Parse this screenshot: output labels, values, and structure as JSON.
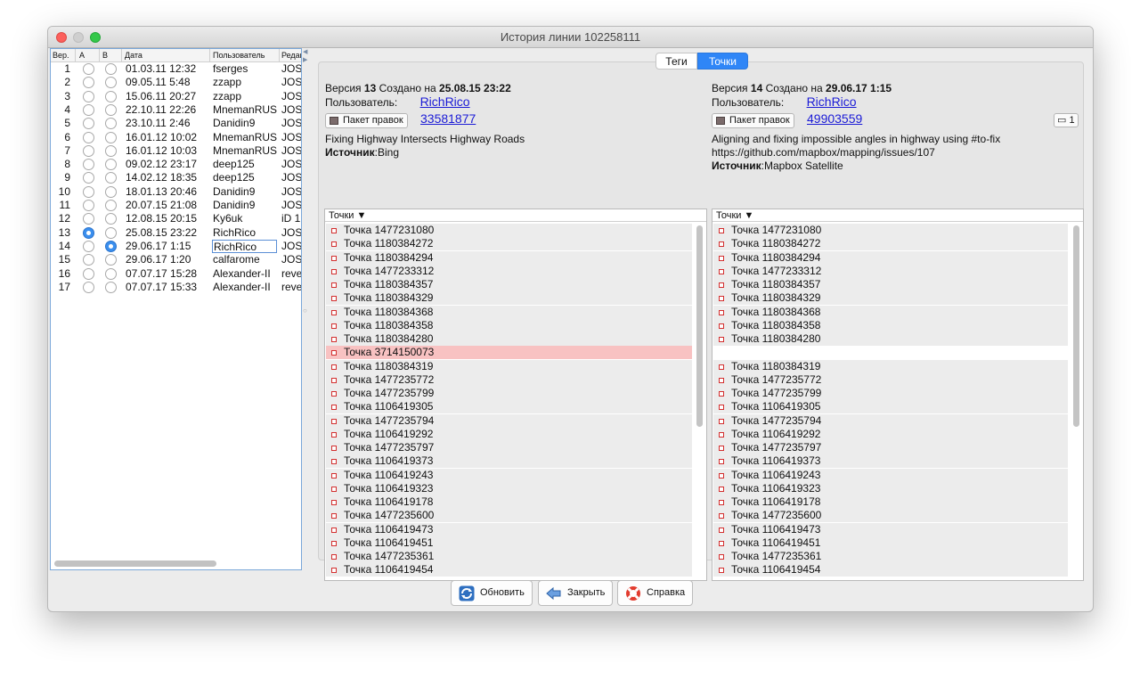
{
  "window": {
    "title": "История линии 102258111"
  },
  "history": {
    "headers": {
      "ver": "Вер.",
      "a": "A",
      "b": "B",
      "date": "Дата",
      "user": "Пользователь",
      "editor": "Редакт"
    },
    "rows": [
      {
        "n": "1",
        "date": "01.03.11 12:32",
        "user": "fserges",
        "editor": "JOSM",
        "a": false,
        "b": false
      },
      {
        "n": "2",
        "date": "09.05.11 5:48",
        "user": "zzapp",
        "editor": "JOSM",
        "a": false,
        "b": false
      },
      {
        "n": "3",
        "date": "15.06.11 20:27",
        "user": "zzapp",
        "editor": "JOSM",
        "a": false,
        "b": false
      },
      {
        "n": "4",
        "date": "22.10.11 22:26",
        "user": "MnemanRUS",
        "editor": "JOSM",
        "a": false,
        "b": false
      },
      {
        "n": "5",
        "date": "23.10.11 2:46",
        "user": "Danidin9",
        "editor": "JOSM",
        "a": false,
        "b": false
      },
      {
        "n": "6",
        "date": "16.01.12 10:02",
        "user": "MnemanRUS",
        "editor": "JOSM",
        "a": false,
        "b": false
      },
      {
        "n": "7",
        "date": "16.01.12 10:03",
        "user": "MnemanRUS",
        "editor": "JOSM",
        "a": false,
        "b": false
      },
      {
        "n": "8",
        "date": "09.02.12 23:17",
        "user": "deep125",
        "editor": "JOSM",
        "a": false,
        "b": false
      },
      {
        "n": "9",
        "date": "14.02.12 18:35",
        "user": "deep125",
        "editor": "JOSM",
        "a": false,
        "b": false
      },
      {
        "n": "10",
        "date": "18.01.13 20:46",
        "user": "Danidin9",
        "editor": "JOSM",
        "a": false,
        "b": false
      },
      {
        "n": "11",
        "date": "20.07.15 21:08",
        "user": "Danidin9",
        "editor": "JOSM",
        "a": false,
        "b": false
      },
      {
        "n": "12",
        "date": "12.08.15 20:15",
        "user": "Ky6uk",
        "editor": "iD 1",
        "a": false,
        "b": false
      },
      {
        "n": "13",
        "date": "25.08.15 23:22",
        "user": "RichRico",
        "editor": "JOSM",
        "a": true,
        "b": false
      },
      {
        "n": "14",
        "date": "29.06.17 1:15",
        "user": "RichRico",
        "editor": "JOSM",
        "a": false,
        "b": true,
        "selected": true
      },
      {
        "n": "15",
        "date": "29.06.17 1:20",
        "user": "calfarome",
        "editor": "JOSM",
        "a": false,
        "b": false
      },
      {
        "n": "16",
        "date": "07.07.17 15:28",
        "user": "Alexander-II",
        "editor": "reve",
        "a": false,
        "b": false
      },
      {
        "n": "17",
        "date": "07.07.17 15:33",
        "user": "Alexander-II",
        "editor": "reve",
        "a": false,
        "b": false
      }
    ]
  },
  "tabs": {
    "tags": "Теги",
    "points": "Точки"
  },
  "left_version": {
    "version_prefix": "Версия",
    "version_num": "13",
    "created_label": "Создано на",
    "created": "25.08.15 23:22",
    "user_label": "Пользователь:",
    "user": "RichRico",
    "changeset_button": "Пакет правок",
    "changeset_id": "33581877",
    "comment": "Fixing Highway Intersects Highway Roads",
    "source_label": "Источник",
    "source": "Bing"
  },
  "right_version": {
    "version_prefix": "Версия",
    "version_num": "14",
    "created_label": "Создано на",
    "created": "29.06.17 1:15",
    "user_label": "Пользователь:",
    "user": "RichRico",
    "changeset_button": "Пакет правок",
    "changeset_id": "49903559",
    "comments_count": "1",
    "comment": "Aligning and fixing impossible angles in highway using #to-fix",
    "url": "https://github.com/mapbox/mapping/issues/107",
    "source_label": "Источник",
    "source": "Mapbox Satellite"
  },
  "points_header": "Точки ▼",
  "left_points": [
    {
      "label": "Точка 1477231080"
    },
    {
      "label": "Точка 1180384272"
    },
    {
      "label": "Точка 1180384294"
    },
    {
      "label": "Точка 1477233312"
    },
    {
      "label": "Точка 1180384357"
    },
    {
      "label": "Точка 1180384329"
    },
    {
      "label": "Точка 1180384368"
    },
    {
      "label": "Точка 1180384358"
    },
    {
      "label": "Точка 1180384280"
    },
    {
      "label": "Точка 3714150073",
      "diff": true
    },
    {
      "label": "Точка 1180384319"
    },
    {
      "label": "Точка 1477235772"
    },
    {
      "label": "Точка 1477235799"
    },
    {
      "label": "Точка 1106419305"
    },
    {
      "label": "Точка 1477235794"
    },
    {
      "label": "Точка 1106419292"
    },
    {
      "label": "Точка 1477235797"
    },
    {
      "label": "Точка 1106419373"
    },
    {
      "label": "Точка 1106419243"
    },
    {
      "label": "Точка 1106419323"
    },
    {
      "label": "Точка 1106419178"
    },
    {
      "label": "Точка 1477235600"
    },
    {
      "label": "Точка 1106419473"
    },
    {
      "label": "Точка 1106419451"
    },
    {
      "label": "Точка 1477235361"
    },
    {
      "label": "Точка 1106419454"
    }
  ],
  "right_points": [
    {
      "label": "Точка 1477231080"
    },
    {
      "label": "Точка 1180384272"
    },
    {
      "label": "Точка 1180384294"
    },
    {
      "label": "Точка 1477233312"
    },
    {
      "label": "Точка 1180384357"
    },
    {
      "label": "Точка 1180384329"
    },
    {
      "label": "Точка 1180384368"
    },
    {
      "label": "Точка 1180384358"
    },
    {
      "label": "Точка 1180384280"
    },
    {
      "label": "",
      "empty": true
    },
    {
      "label": "Точка 1180384319"
    },
    {
      "label": "Точка 1477235772"
    },
    {
      "label": "Точка 1477235799"
    },
    {
      "label": "Точка 1106419305"
    },
    {
      "label": "Точка 1477235794"
    },
    {
      "label": "Точка 1106419292"
    },
    {
      "label": "Точка 1477235797"
    },
    {
      "label": "Точка 1106419373"
    },
    {
      "label": "Точка 1106419243"
    },
    {
      "label": "Точка 1106419323"
    },
    {
      "label": "Точка 1106419178"
    },
    {
      "label": "Точка 1477235600"
    },
    {
      "label": "Точка 1106419473"
    },
    {
      "label": "Точка 1106419451"
    },
    {
      "label": "Точка 1477235361"
    },
    {
      "label": "Точка 1106419454"
    }
  ],
  "buttons": {
    "refresh": "Обновить",
    "close": "Закрыть",
    "help": "Справка"
  },
  "icons": {
    "refresh": "refresh-icon",
    "close": "close-arrow-icon",
    "help": "lifebuoy-icon",
    "changeset": "changeset-icon",
    "comment": "comment-icon"
  },
  "colors": {
    "accent": "#2f86f7",
    "diff_row": "#f8c2c2",
    "link": "#1b1bd6"
  }
}
